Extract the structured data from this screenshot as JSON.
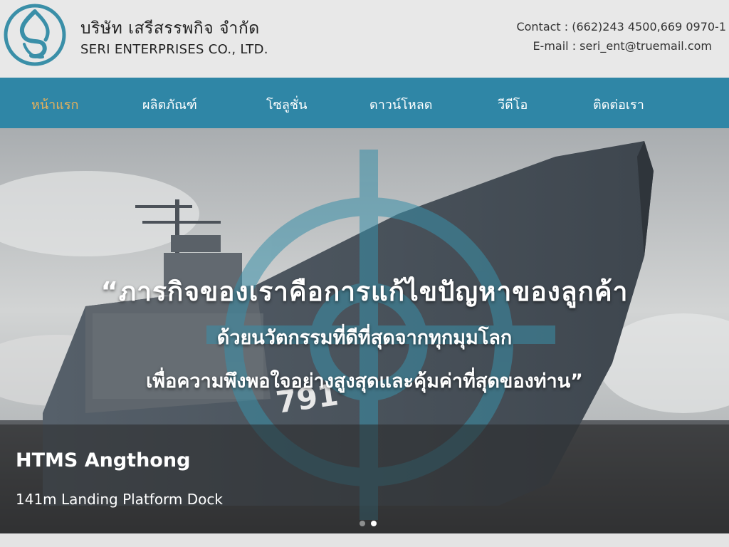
{
  "header": {
    "company_th": "บริษัท เสรีสรรพกิจ จำกัด",
    "company_en": "SERI ENTERPRISES CO., LTD.",
    "contact": "Contact : (662)243 4500,669 0970-1",
    "email": "E-mail : seri_ent@truemail.com"
  },
  "nav": {
    "items": [
      {
        "label": "หน้าแรก",
        "active": true
      },
      {
        "label": "ผลิตภัณฑ์"
      },
      {
        "label": "โซลูชั่น"
      },
      {
        "label": "ดาวน์โหลด"
      },
      {
        "label": "วีดีโอ"
      },
      {
        "label": "ติดต่อเรา"
      }
    ]
  },
  "hero": {
    "slogan_line1": "“ภารกิจของเราคือการแก้ไขปัญหาของลูกค้า",
    "slogan_line2": "ด้วยนวัตกรรมที่ดีที่สุดจากทุกมุมโลก",
    "slogan_line3": "เพื่อความพึงพอใจอย่างสูงสุดและคุ้มค่าที่สุดของท่าน”",
    "caption_title": "HTMS Angthong",
    "caption_subtitle": "141m Landing Platform Dock",
    "hull_number": "791",
    "slide_count": 2,
    "active_slide": 2
  },
  "colors": {
    "nav_bg": "#2f86a6",
    "nav_active": "#e8b15a",
    "logo_teal": "#3a8fa8",
    "header_bg": "#e8e8e8"
  },
  "icons": {
    "logo": "seri-logo-icon",
    "crosshair": "crosshair-watermark-icon"
  }
}
